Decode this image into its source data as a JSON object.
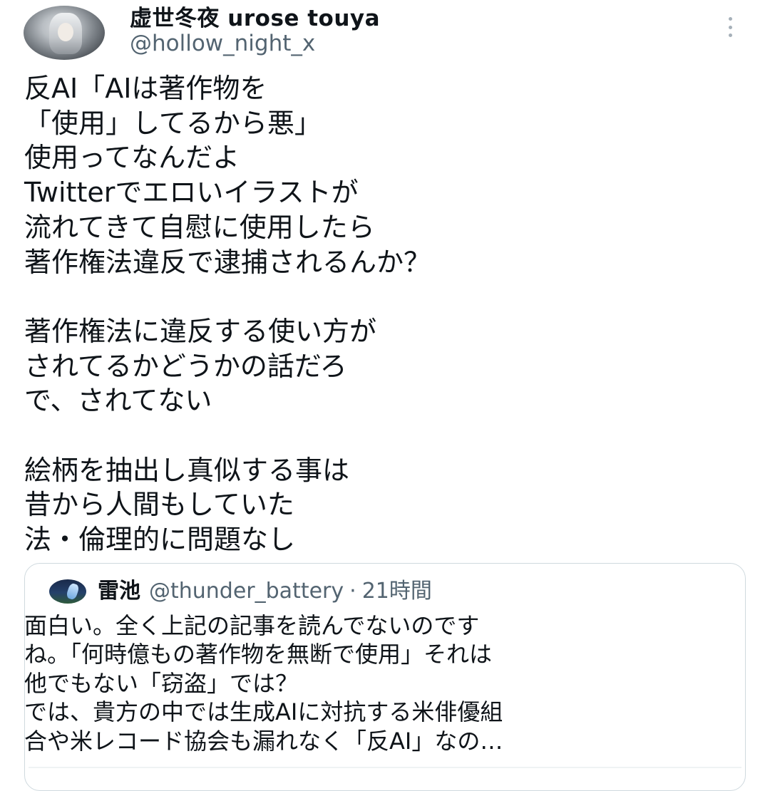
{
  "author": {
    "display_name": "虚世冬夜 urose touya",
    "handle": "@hollow_night_x",
    "avatar_icon": "user-avatar-icon",
    "more_icon": "more-vertical-icon"
  },
  "tweet": {
    "text": "反AI「AIは著作物を\n「使用」してるから悪」\n使用ってなんだよ\nTwitterでエロいイラストが\n流れてきて自慰に使用したら\n著作権法違反で逮捕されるんか？\n\n著作権法に違反する使い方が\nされてるかどうかの話だろ\nで、されてない\n\n絵柄を抽出し真似する事は\n昔から人間もしていた\n法・倫理的に問題なし"
  },
  "quote": {
    "display_name": "雷池",
    "handle": "@thunder_battery",
    "separator": "·",
    "time": "21時間",
    "text": "面白い。全く上記の記事を読んでないのです\nね。「何時億もの著作物を無断で使用」それは\n他でもない「窃盗」では？\nでは、貴方の中では生成AIに対抗する米俳優組\n合や米レコード協会も漏れなく「反AI」なの…"
  },
  "colors": {
    "text": "#0f1419",
    "secondary": "#536471",
    "border": "#cfd9de"
  }
}
